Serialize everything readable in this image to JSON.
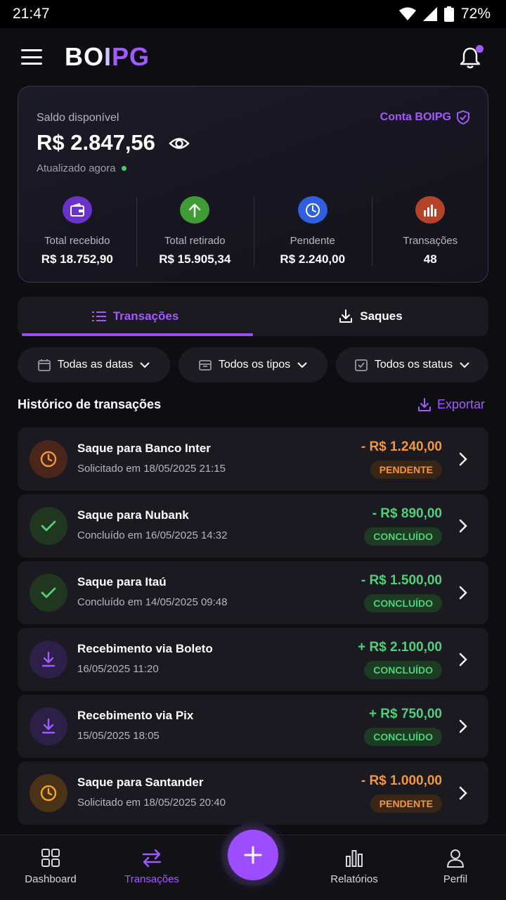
{
  "status": {
    "time": "21:47",
    "battery": "72%"
  },
  "header": {
    "logo_white_1": "BO",
    "logo_white_2": "I",
    "logo_purple": "PG"
  },
  "balance": {
    "label": "Saldo disponível",
    "value": "R$ 2.847,56",
    "updated": "Atualizado agora",
    "account": "Conta BOIPG"
  },
  "stats": [
    {
      "label": "Total recebido",
      "value": "R$ 18.752,90",
      "icon": "wallet-icon",
      "color": "#7b3fe0"
    },
    {
      "label": "Total retirado",
      "value": "R$ 15.905,34",
      "icon": "arrow-up-icon",
      "color": "#3f9b34"
    },
    {
      "label": "Pendente",
      "value": "R$ 2.240,00",
      "icon": "clock-icon",
      "color": "#2f5fe0"
    },
    {
      "label": "Transações",
      "value": "48",
      "icon": "bar-chart-icon",
      "color": "#c4492b"
    }
  ],
  "tabs": {
    "transactions": "Transações",
    "withdrawals": "Saques"
  },
  "filters": {
    "dates": "Todas as datas",
    "types": "Todos os tipos",
    "status": "Todos os status"
  },
  "section": {
    "title": "Histórico de transações",
    "export": "Exportar"
  },
  "transactions": [
    {
      "title": "Saque para Banco Inter",
      "subtitle": "Solicitado em 18/05/2025 21:15",
      "amount": "- R$ 1.240,00",
      "badge": "PENDENTE",
      "kind": "pending"
    },
    {
      "title": "Saque para Nubank",
      "subtitle": "Concluído em 16/05/2025 14:32",
      "amount": "- R$ 890,00",
      "badge": "CONCLUÍDO",
      "kind": "done"
    },
    {
      "title": "Saque para Itaú",
      "subtitle": "Concluído em 14/05/2025 09:48",
      "amount": "- R$ 1.500,00",
      "badge": "CONCLUÍDO",
      "kind": "done"
    },
    {
      "title": "Recebimento via Boleto",
      "subtitle": "16/05/2025 11:20",
      "amount": "+ R$ 2.100,00",
      "badge": "CONCLUÍDO",
      "kind": "received"
    },
    {
      "title": "Recebimento via Pix",
      "subtitle": "15/05/2025 18:05",
      "amount": "+ R$ 750,00",
      "badge": "CONCLUÍDO",
      "kind": "received"
    },
    {
      "title": "Saque para Santander",
      "subtitle": "Solicitado em 18/05/2025 20:40",
      "amount": "- R$ 1.000,00",
      "badge": "PENDENTE",
      "kind": "pending-amber"
    }
  ],
  "nav": {
    "dashboard": "Dashboard",
    "transactions": "Transações",
    "reports": "Relatórios",
    "profile": "Perfil"
  },
  "colors": {
    "accent": "#a259ff",
    "pending": "#f4963b",
    "success": "#4fd07a",
    "background": "#0e0e12"
  }
}
